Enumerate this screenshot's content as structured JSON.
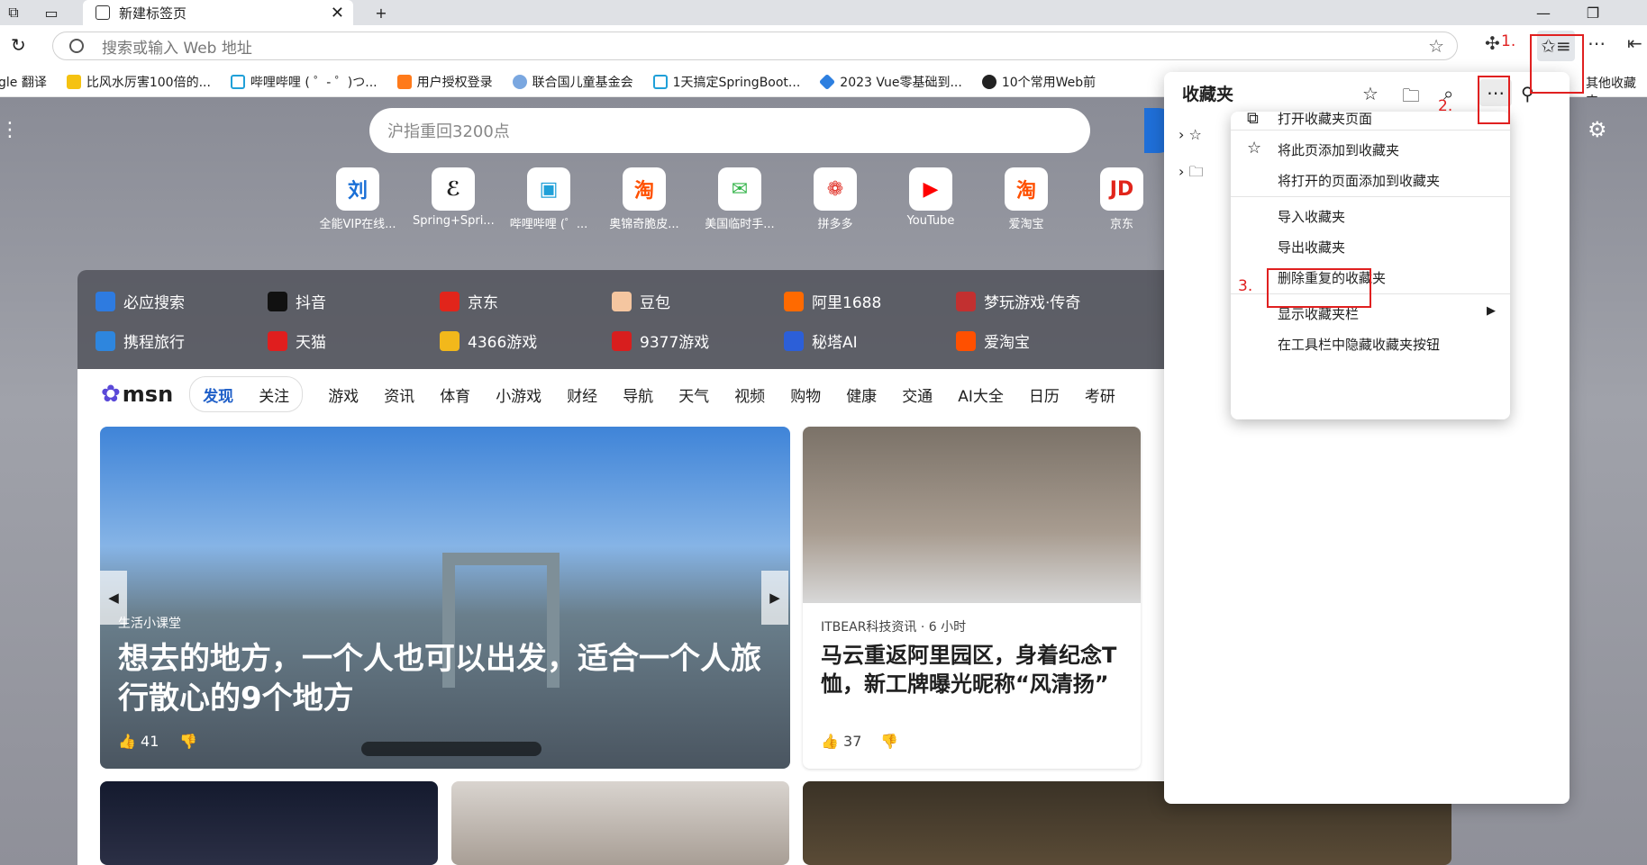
{
  "tab": {
    "title": "新建标签页",
    "close": "✕",
    "new": "+"
  },
  "window": {
    "minimize": "—",
    "restore": "❐"
  },
  "address": {
    "placeholder": "搜索或输入 Web 地址"
  },
  "favorites_bar": [
    "gle 翻译",
    "比风水厉害100倍的...",
    "哔哩哔哩 ( ゜- ゜)つ...",
    "用户授权登录",
    "联合国儿童基金会",
    "1天搞定SpringBoot...",
    "2023 Vue零基础到...",
    "10个常用Web前",
    "其他收藏夹"
  ],
  "search": {
    "placeholder": "沪指重回3200点"
  },
  "quick_links": [
    {
      "label": "全能VIP在线...",
      "glyph": "刘",
      "color": "#1a6fd6"
    },
    {
      "label": "Spring+Spri...",
      "glyph": "ℰ",
      "color": "#222"
    },
    {
      "label": "哔哩哔哩 (゜...",
      "glyph": "▣",
      "color": "#20a0d8"
    },
    {
      "label": "奥锦奇脆皮...",
      "glyph": "淘",
      "color": "#ff5000"
    },
    {
      "label": "美国临时手...",
      "glyph": "✉",
      "color": "#34b44a"
    },
    {
      "label": "拼多多",
      "glyph": "❁",
      "color": "#e02e24"
    },
    {
      "label": "YouTube",
      "glyph": "▶",
      "color": "#ff0000"
    },
    {
      "label": "爱淘宝",
      "glyph": "淘",
      "color": "#ff5000"
    },
    {
      "label": "京东",
      "glyph": "JD",
      "color": "#e1251b"
    }
  ],
  "hot_row1": [
    {
      "label": "必应搜索",
      "color": "#2e7be0"
    },
    {
      "label": "抖音",
      "color": "#111"
    },
    {
      "label": "京东",
      "color": "#e1251b"
    },
    {
      "label": "豆包",
      "color": "#f5c6a0"
    },
    {
      "label": "阿里1688",
      "color": "#ff6a00"
    },
    {
      "label": "梦玩游戏·传奇",
      "color": "#c23030"
    }
  ],
  "hot_row2": [
    {
      "label": "携程旅行",
      "color": "#2e86de"
    },
    {
      "label": "天猫",
      "color": "#e01e1e"
    },
    {
      "label": "4366游戏",
      "color": "#f2b81b"
    },
    {
      "label": "9377游戏",
      "color": "#d81e1e"
    },
    {
      "label": "秘塔AI",
      "color": "#2c5fd8"
    },
    {
      "label": "爱淘宝",
      "color": "#ff5000"
    }
  ],
  "msn": {
    "logo": "msn",
    "discover": "发现",
    "follow": "关注"
  },
  "categories": [
    "游戏",
    "资讯",
    "体育",
    "小游戏",
    "财经",
    "导航",
    "天气",
    "视频",
    "购物",
    "健康",
    "交通",
    "AI大全",
    "日历",
    "考研"
  ],
  "hero": {
    "source": "生活小课堂",
    "headline": "想去的地方，一个人也可以出发，适合一个人旅行散心的9个地方",
    "likes": "41"
  },
  "side_card": {
    "source": "ITBEAR科技资讯 · 6 小时",
    "headline": "马云重返阿里园区，身着纪念T恤，新工牌曝光昵称“风清扬”",
    "likes": "37"
  },
  "flyout": {
    "title": "收藏夹"
  },
  "menu": {
    "items": [
      "打开收藏夹页面",
      "将此页添加到收藏夹",
      "将打开的页面添加到收藏夹",
      "导入收藏夹",
      "导出收藏夹",
      "删除重复的收藏夹",
      "显示收藏夹栏",
      "在工具栏中隐藏收藏夹按钮"
    ]
  },
  "annotations": {
    "step1": "1.",
    "step2": "2.",
    "step3": "3."
  }
}
